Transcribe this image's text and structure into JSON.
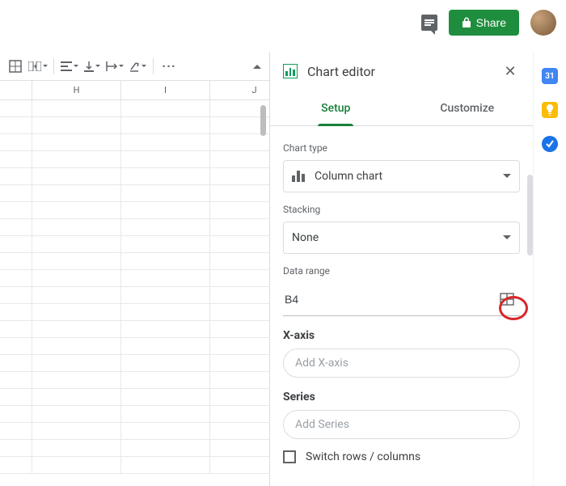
{
  "topbar": {
    "share_label": "Share"
  },
  "chart_editor": {
    "title": "Chart editor",
    "tabs": {
      "setup": "Setup",
      "customize": "Customize"
    },
    "chart_type_label": "Chart type",
    "chart_type_value": "Column chart",
    "stacking_label": "Stacking",
    "stacking_value": "None",
    "data_range_label": "Data range",
    "data_range_value": "B4",
    "xaxis_label": "X-axis",
    "xaxis_button": "Add X-axis",
    "series_label": "Series",
    "series_button": "Add Series",
    "switch_rows_label": "Switch rows / columns"
  },
  "columns": [
    "H",
    "I",
    "J"
  ],
  "sidebar": {
    "calendar_day": "31"
  }
}
